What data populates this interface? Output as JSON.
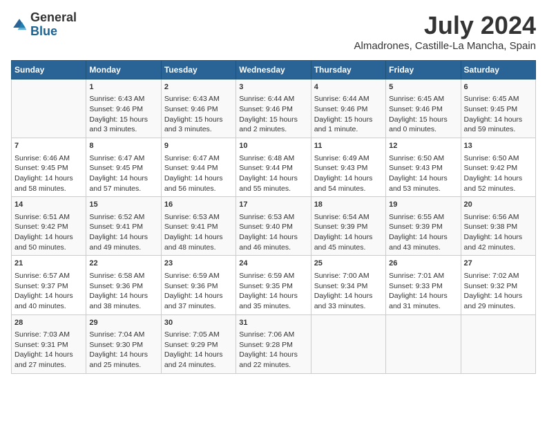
{
  "logo": {
    "general": "General",
    "blue": "Blue"
  },
  "header": {
    "month": "July 2024",
    "location": "Almadrones, Castille-La Mancha, Spain"
  },
  "days_of_week": [
    "Sunday",
    "Monday",
    "Tuesday",
    "Wednesday",
    "Thursday",
    "Friday",
    "Saturday"
  ],
  "weeks": [
    [
      {
        "day": "",
        "content": ""
      },
      {
        "day": "1",
        "content": "Sunrise: 6:43 AM\nSunset: 9:46 PM\nDaylight: 15 hours\nand 3 minutes."
      },
      {
        "day": "2",
        "content": "Sunrise: 6:43 AM\nSunset: 9:46 PM\nDaylight: 15 hours\nand 3 minutes."
      },
      {
        "day": "3",
        "content": "Sunrise: 6:44 AM\nSunset: 9:46 PM\nDaylight: 15 hours\nand 2 minutes."
      },
      {
        "day": "4",
        "content": "Sunrise: 6:44 AM\nSunset: 9:46 PM\nDaylight: 15 hours\nand 1 minute."
      },
      {
        "day": "5",
        "content": "Sunrise: 6:45 AM\nSunset: 9:46 PM\nDaylight: 15 hours\nand 0 minutes."
      },
      {
        "day": "6",
        "content": "Sunrise: 6:45 AM\nSunset: 9:45 PM\nDaylight: 14 hours\nand 59 minutes."
      }
    ],
    [
      {
        "day": "7",
        "content": "Sunrise: 6:46 AM\nSunset: 9:45 PM\nDaylight: 14 hours\nand 58 minutes."
      },
      {
        "day": "8",
        "content": "Sunrise: 6:47 AM\nSunset: 9:45 PM\nDaylight: 14 hours\nand 57 minutes."
      },
      {
        "day": "9",
        "content": "Sunrise: 6:47 AM\nSunset: 9:44 PM\nDaylight: 14 hours\nand 56 minutes."
      },
      {
        "day": "10",
        "content": "Sunrise: 6:48 AM\nSunset: 9:44 PM\nDaylight: 14 hours\nand 55 minutes."
      },
      {
        "day": "11",
        "content": "Sunrise: 6:49 AM\nSunset: 9:43 PM\nDaylight: 14 hours\nand 54 minutes."
      },
      {
        "day": "12",
        "content": "Sunrise: 6:50 AM\nSunset: 9:43 PM\nDaylight: 14 hours\nand 53 minutes."
      },
      {
        "day": "13",
        "content": "Sunrise: 6:50 AM\nSunset: 9:42 PM\nDaylight: 14 hours\nand 52 minutes."
      }
    ],
    [
      {
        "day": "14",
        "content": "Sunrise: 6:51 AM\nSunset: 9:42 PM\nDaylight: 14 hours\nand 50 minutes."
      },
      {
        "day": "15",
        "content": "Sunrise: 6:52 AM\nSunset: 9:41 PM\nDaylight: 14 hours\nand 49 minutes."
      },
      {
        "day": "16",
        "content": "Sunrise: 6:53 AM\nSunset: 9:41 PM\nDaylight: 14 hours\nand 48 minutes."
      },
      {
        "day": "17",
        "content": "Sunrise: 6:53 AM\nSunset: 9:40 PM\nDaylight: 14 hours\nand 46 minutes."
      },
      {
        "day": "18",
        "content": "Sunrise: 6:54 AM\nSunset: 9:39 PM\nDaylight: 14 hours\nand 45 minutes."
      },
      {
        "day": "19",
        "content": "Sunrise: 6:55 AM\nSunset: 9:39 PM\nDaylight: 14 hours\nand 43 minutes."
      },
      {
        "day": "20",
        "content": "Sunrise: 6:56 AM\nSunset: 9:38 PM\nDaylight: 14 hours\nand 42 minutes."
      }
    ],
    [
      {
        "day": "21",
        "content": "Sunrise: 6:57 AM\nSunset: 9:37 PM\nDaylight: 14 hours\nand 40 minutes."
      },
      {
        "day": "22",
        "content": "Sunrise: 6:58 AM\nSunset: 9:36 PM\nDaylight: 14 hours\nand 38 minutes."
      },
      {
        "day": "23",
        "content": "Sunrise: 6:59 AM\nSunset: 9:36 PM\nDaylight: 14 hours\nand 37 minutes."
      },
      {
        "day": "24",
        "content": "Sunrise: 6:59 AM\nSunset: 9:35 PM\nDaylight: 14 hours\nand 35 minutes."
      },
      {
        "day": "25",
        "content": "Sunrise: 7:00 AM\nSunset: 9:34 PM\nDaylight: 14 hours\nand 33 minutes."
      },
      {
        "day": "26",
        "content": "Sunrise: 7:01 AM\nSunset: 9:33 PM\nDaylight: 14 hours\nand 31 minutes."
      },
      {
        "day": "27",
        "content": "Sunrise: 7:02 AM\nSunset: 9:32 PM\nDaylight: 14 hours\nand 29 minutes."
      }
    ],
    [
      {
        "day": "28",
        "content": "Sunrise: 7:03 AM\nSunset: 9:31 PM\nDaylight: 14 hours\nand 27 minutes."
      },
      {
        "day": "29",
        "content": "Sunrise: 7:04 AM\nSunset: 9:30 PM\nDaylight: 14 hours\nand 25 minutes."
      },
      {
        "day": "30",
        "content": "Sunrise: 7:05 AM\nSunset: 9:29 PM\nDaylight: 14 hours\nand 24 minutes."
      },
      {
        "day": "31",
        "content": "Sunrise: 7:06 AM\nSunset: 9:28 PM\nDaylight: 14 hours\nand 22 minutes."
      },
      {
        "day": "",
        "content": ""
      },
      {
        "day": "",
        "content": ""
      },
      {
        "day": "",
        "content": ""
      }
    ]
  ]
}
